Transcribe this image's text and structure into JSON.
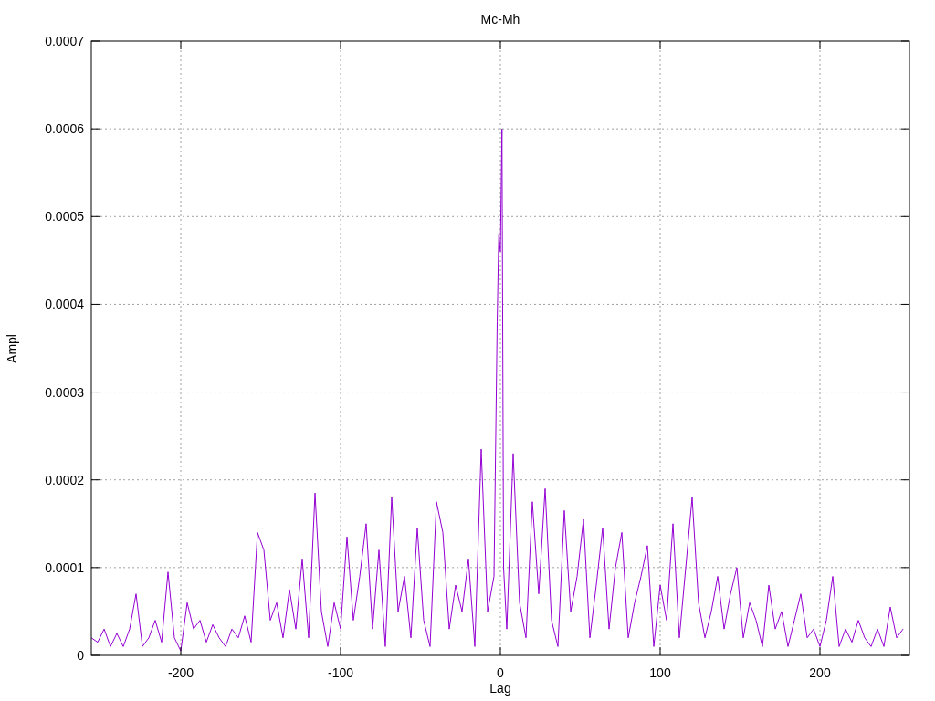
{
  "plot": {
    "chart_data": {
      "type": "line",
      "grid": true,
      "title": "Mc-Mh",
      "xlabel": "Lag",
      "ylabel": "Ampl",
      "xlim": [
        -256,
        256
      ],
      "ylim": [
        0,
        0.0007
      ],
      "xticks": [
        -200,
        -100,
        0,
        100,
        200
      ],
      "yticks": [
        {
          "value": 0,
          "label": "0"
        },
        {
          "value": 0.0001,
          "label": "0.0001"
        },
        {
          "value": 0.0002,
          "label": "0.0002"
        },
        {
          "value": 0.0003,
          "label": "0.0003"
        },
        {
          "value": 0.0004,
          "label": "0.0004"
        },
        {
          "value": 0.0005,
          "label": "0.0005"
        },
        {
          "value": 0.0006,
          "label": "0.0006"
        },
        {
          "value": 0.0007,
          "label": "0.0007"
        }
      ],
      "x": [
        -256,
        -252,
        -248,
        -244,
        -240,
        -236,
        -232,
        -228,
        -224,
        -220,
        -216,
        -212,
        -208,
        -204,
        -200,
        -196,
        -192,
        -188,
        -184,
        -180,
        -176,
        -172,
        -168,
        -164,
        -160,
        -156,
        -152,
        -148,
        -144,
        -140,
        -136,
        -132,
        -128,
        -124,
        -120,
        -116,
        -112,
        -108,
        -104,
        -100,
        -96,
        -92,
        -88,
        -84,
        -80,
        -76,
        -72,
        -68,
        -64,
        -60,
        -56,
        -52,
        -48,
        -44,
        -40,
        -36,
        -32,
        -28,
        -24,
        -20,
        -16,
        -12,
        -8,
        -4,
        -2,
        -1,
        0,
        1,
        2,
        4,
        8,
        12,
        16,
        20,
        24,
        28,
        32,
        36,
        40,
        44,
        48,
        52,
        56,
        60,
        64,
        68,
        72,
        76,
        80,
        84,
        88,
        92,
        96,
        100,
        104,
        108,
        112,
        116,
        120,
        124,
        128,
        132,
        136,
        140,
        144,
        148,
        152,
        156,
        160,
        164,
        168,
        172,
        176,
        180,
        184,
        188,
        192,
        196,
        200,
        204,
        208,
        212,
        216,
        220,
        224,
        228,
        232,
        236,
        240,
        244,
        248,
        252
      ],
      "series": [
        {
          "color": "#9400d3",
          "values": [
            2e-05,
            1.5e-05,
            3e-05,
            1e-05,
            2.5e-05,
            1e-05,
            3e-05,
            7e-05,
            1e-05,
            2e-05,
            4e-05,
            1.5e-05,
            9.5e-05,
            2e-05,
            5e-06,
            6e-05,
            3e-05,
            4e-05,
            1.5e-05,
            3.5e-05,
            2e-05,
            1e-05,
            3e-05,
            2e-05,
            4.5e-05,
            1.5e-05,
            0.00014,
            0.00012,
            4e-05,
            6e-05,
            2e-05,
            7.5e-05,
            3e-05,
            0.00011,
            2e-05,
            0.000185,
            5e-05,
            1e-05,
            6e-05,
            3e-05,
            0.000135,
            4e-05,
            9e-05,
            0.00015,
            3e-05,
            0.00012,
            1e-05,
            0.00018,
            5e-05,
            9e-05,
            2e-05,
            0.000145,
            4e-05,
            1e-05,
            0.000175,
            0.00014,
            3e-05,
            8e-05,
            5e-05,
            0.00011,
            1e-05,
            0.000235,
            5e-05,
            9e-05,
            0.00038,
            0.00048,
            0.00046,
            0.0006,
            0.0001,
            3e-05,
            0.00023,
            6e-05,
            2e-05,
            0.000175,
            7e-05,
            0.00019,
            4e-05,
            1e-05,
            0.000165,
            5e-05,
            9e-05,
            0.000155,
            2e-05,
            8e-05,
            0.000145,
            3e-05,
            0.0001,
            0.00014,
            2e-05,
            6e-05,
            9e-05,
            0.000125,
            1e-05,
            8e-05,
            4e-05,
            0.00015,
            2e-05,
            0.0001,
            0.00018,
            6e-05,
            2e-05,
            5e-05,
            9e-05,
            3e-05,
            7e-05,
            0.0001,
            2e-05,
            6e-05,
            4e-05,
            1e-05,
            8e-05,
            3e-05,
            5e-05,
            1e-05,
            4e-05,
            7e-05,
            2e-05,
            3e-05,
            1e-05,
            4e-05,
            9e-05,
            1e-05,
            3e-05,
            1.5e-05,
            4e-05,
            2e-05,
            1e-05,
            3e-05,
            1e-05,
            5.5e-05,
            2e-05,
            3e-05
          ]
        }
      ]
    }
  }
}
